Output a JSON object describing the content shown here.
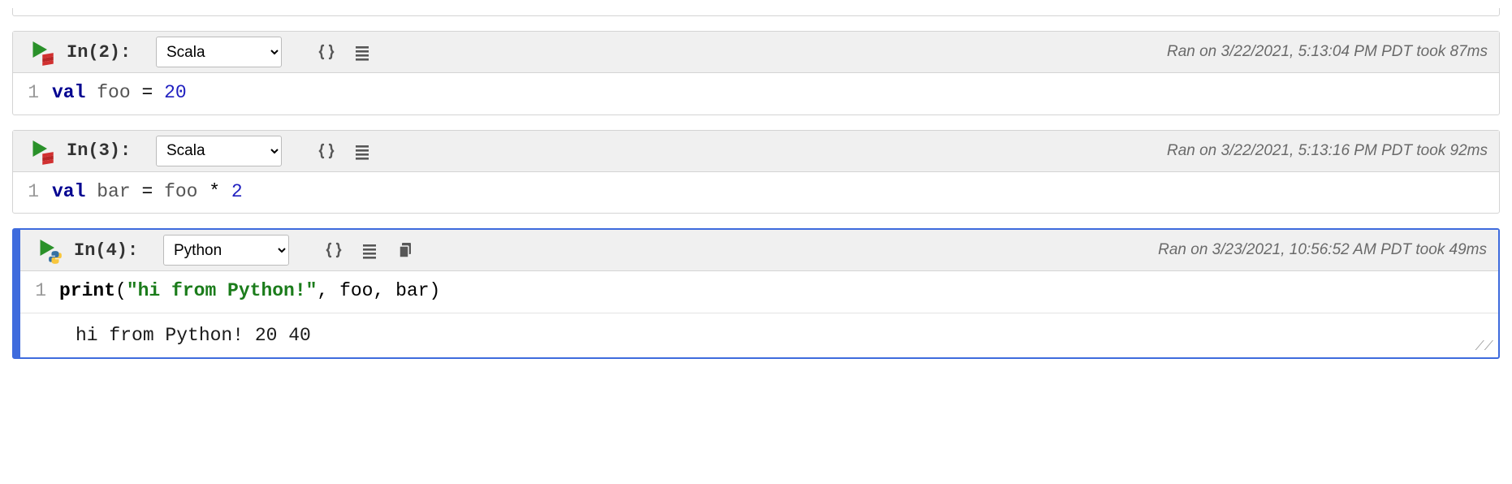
{
  "partial_top": true,
  "cells": [
    {
      "label": "In(2):",
      "lang": "Scala",
      "lang_options": [
        "Scala",
        "Python"
      ],
      "status": "Ran on 3/22/2021, 5:13:04 PM PDT took 87ms",
      "active": false,
      "show_clipboard": false,
      "code": {
        "line_no": "1",
        "tokens": [
          {
            "t": "val",
            "c": "kw"
          },
          {
            "t": " ",
            "c": ""
          },
          {
            "t": "foo",
            "c": "ident"
          },
          {
            "t": " = ",
            "c": ""
          },
          {
            "t": "20",
            "c": "num"
          }
        ]
      },
      "output": null
    },
    {
      "label": "In(3):",
      "lang": "Scala",
      "lang_options": [
        "Scala",
        "Python"
      ],
      "status": "Ran on 3/22/2021, 5:13:16 PM PDT took 92ms",
      "active": false,
      "show_clipboard": false,
      "code": {
        "line_no": "1",
        "tokens": [
          {
            "t": "val",
            "c": "kw"
          },
          {
            "t": " ",
            "c": ""
          },
          {
            "t": "bar",
            "c": "ident"
          },
          {
            "t": " = ",
            "c": ""
          },
          {
            "t": "foo",
            "c": "ident"
          },
          {
            "t": " * ",
            "c": ""
          },
          {
            "t": "2",
            "c": "num"
          }
        ]
      },
      "output": null
    },
    {
      "label": "In(4):",
      "lang": "Python",
      "lang_options": [
        "Scala",
        "Python"
      ],
      "status": "Ran on 3/23/2021, 10:56:52 AM PDT took 49ms",
      "active": true,
      "show_clipboard": true,
      "code": {
        "line_no": "1",
        "tokens": [
          {
            "t": "print",
            "c": "call"
          },
          {
            "t": "(",
            "c": ""
          },
          {
            "t": "\"hi from Python!\"",
            "c": "str"
          },
          {
            "t": ", foo, bar)",
            "c": ""
          }
        ]
      },
      "output": "hi from Python! 20 40"
    }
  ]
}
